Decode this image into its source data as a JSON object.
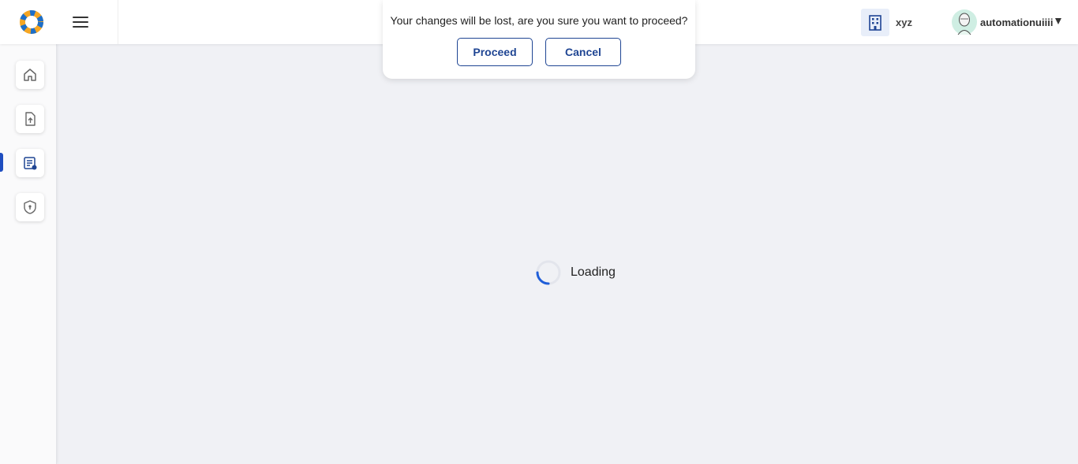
{
  "header": {
    "org_name": "xyz",
    "user_name": "automationuiiii"
  },
  "sidebar": {
    "items": [
      {
        "name": "home",
        "icon": "home-icon"
      },
      {
        "name": "upload",
        "icon": "file-upload-icon"
      },
      {
        "name": "documents",
        "icon": "document-list-icon",
        "active": true
      },
      {
        "name": "security",
        "icon": "shield-icon"
      }
    ]
  },
  "main": {
    "loading_text": "Loading"
  },
  "dialog": {
    "message": "Your changes will be lost, are you sure you want to proceed?",
    "proceed_label": "Proceed",
    "cancel_label": "Cancel"
  },
  "colors": {
    "accent": "#1f4593",
    "active_indicator": "#1f4ec0",
    "background": "#f0f1f5"
  }
}
